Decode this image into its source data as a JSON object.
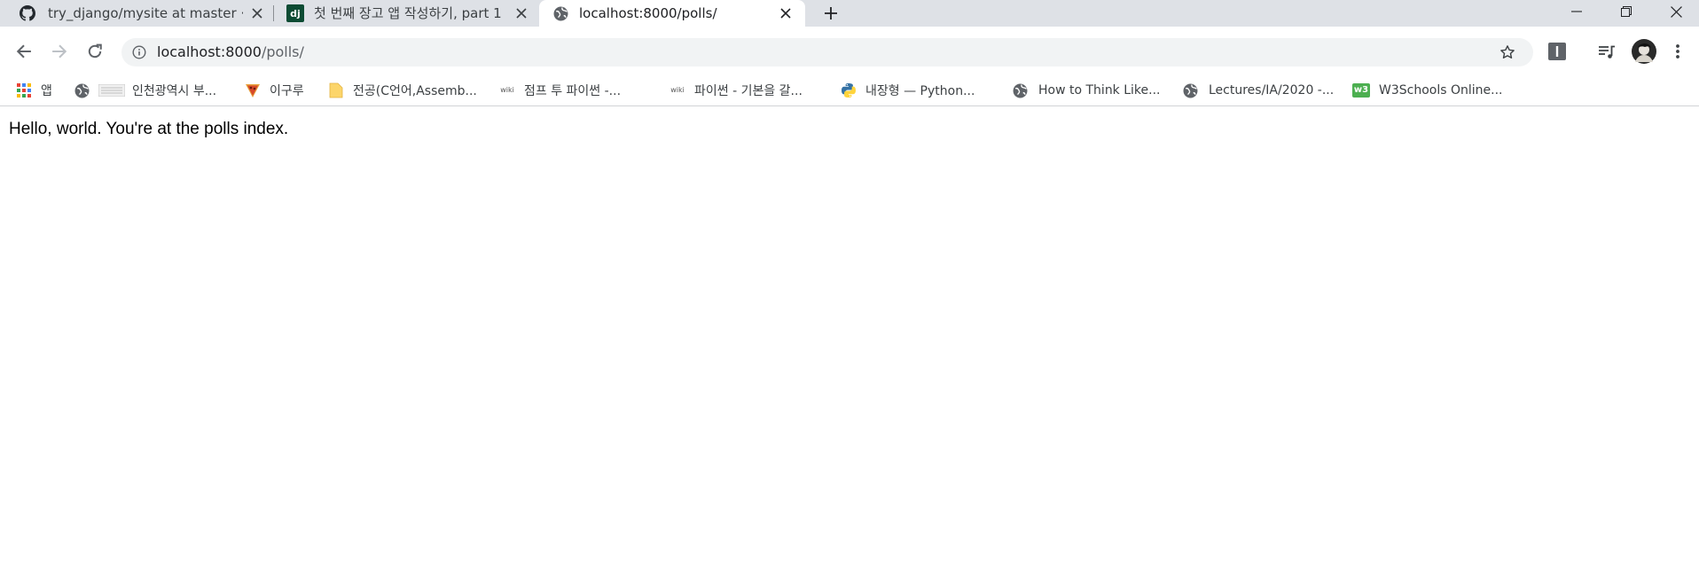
{
  "tabs": [
    {
      "title": "try_django/mysite at master · de",
      "icon": "github-icon",
      "active": false
    },
    {
      "title": "첫 번째 장고 앱 작성하기, part 1",
      "icon": "django-icon",
      "active": false
    },
    {
      "title": "localhost:8000/polls/",
      "icon": "globe-icon",
      "active": true
    }
  ],
  "django_favicon_text": "dj",
  "address_bar": {
    "host": "localhost:8000",
    "path": "/polls/"
  },
  "bookmarks": [
    {
      "label": "앱",
      "icon": "apps-grid-icon"
    },
    {
      "label": "인천광역시 부...",
      "icon": "globe-icon"
    },
    {
      "label": "이구루",
      "icon": "pizza-icon"
    },
    {
      "label": "전공(C언어,Assemb...",
      "icon": "folder-icon"
    },
    {
      "label": "점프 투 파이썬 -...",
      "icon": "wiki-icon"
    },
    {
      "label": "파이썬 - 기본을 갈...",
      "icon": "wiki-icon"
    },
    {
      "label": "내장형 — Python...",
      "icon": "python-icon"
    },
    {
      "label": "How to Think Like...",
      "icon": "globe-icon"
    },
    {
      "label": "Lectures/IA/2020 -...",
      "icon": "globe-icon"
    },
    {
      "label": "W3Schools Online...",
      "icon": "w3schools-icon"
    }
  ],
  "wiki_icon_text": "wiki",
  "w3_icon_text": "w3",
  "page": {
    "text": "Hello, world. You're at the polls index."
  },
  "colors": {
    "tabstrip": "#dee1e6",
    "omnibox": "#f1f3f4",
    "text": "#202124"
  }
}
